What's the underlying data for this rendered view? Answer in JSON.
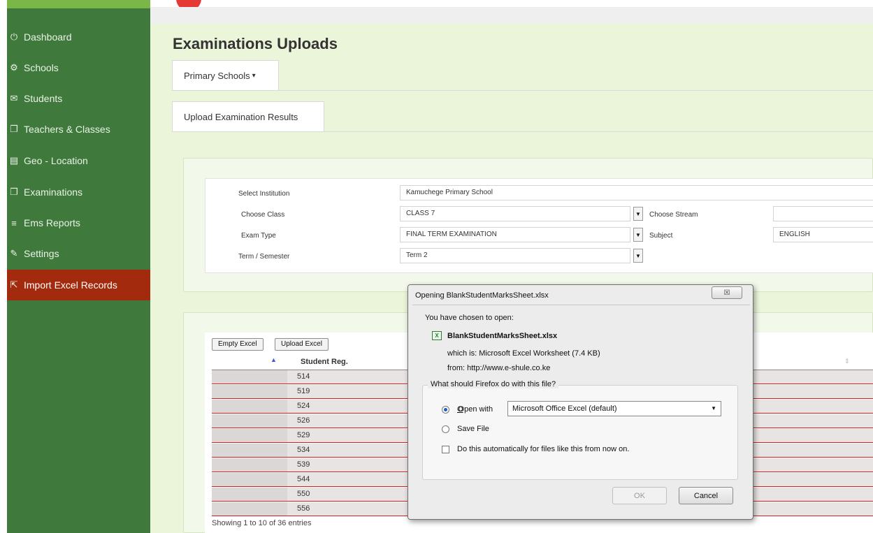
{
  "sidebar": {
    "items": [
      {
        "label": "Dashboard",
        "icon": "power-icon",
        "glyph": "⏻"
      },
      {
        "label": "Schools",
        "icon": "gear-icon",
        "glyph": "⚙"
      },
      {
        "label": "Students",
        "icon": "envelope-icon",
        "glyph": "✉"
      },
      {
        "label": "Teachers & Classes",
        "icon": "book-icon",
        "glyph": "❐"
      },
      {
        "label": "Geo - Location",
        "icon": "map-icon",
        "glyph": "▤"
      },
      {
        "label": "Examinations",
        "icon": "book-icon",
        "glyph": "❐"
      },
      {
        "label": "Ems Reports",
        "icon": "list-icon",
        "glyph": "≡"
      },
      {
        "label": "Settings",
        "icon": "pencil-icon",
        "glyph": "✎"
      },
      {
        "label": "Import Excel Records",
        "icon": "import-icon",
        "glyph": "⇱"
      }
    ]
  },
  "main": {
    "page_title": "Examinations Uploads",
    "tab_primary": "Primary Schools",
    "tab_primary_caret": "▾",
    "tab_upload": "Upload Examination Results",
    "form": {
      "institution_label": "Select Institution",
      "institution_value": "Kamuchege Primary School",
      "class_label": "Choose Class",
      "class_value": "CLASS 7",
      "stream_label": "Choose Stream",
      "stream_value": "",
      "exam_type_label": "Exam Type",
      "exam_type_value": "FINAL TERM EXAMINATION",
      "subject_label": "Subject",
      "subject_value": "ENGLISH",
      "term_label": "Term / Semester",
      "term_value": "Term 2",
      "dropdown_glyph": "▼"
    },
    "table": {
      "btn_empty": "Empty Excel",
      "btn_upload": "Upload Excel",
      "col_reg": "Student Reg.",
      "sort_up": "▲",
      "sort_both": "⇕",
      "rows": [
        "514",
        "519",
        "524",
        "526",
        "529",
        "534",
        "539",
        "544",
        "550",
        "556"
      ],
      "entries_text": "Showing 1 to 10 of 36 entries"
    }
  },
  "dialog": {
    "title": "Opening BlankStudentMarksSheet.xlsx",
    "close_glyph": "☒",
    "chosen_text": "You have chosen to open:",
    "file_icon_glyph": "X",
    "file_name": "BlankStudentMarksSheet.xlsx",
    "which_is": "which is: Microsoft Excel Worksheet (7.4 KB)",
    "from": "from: http://www.e-shule.co.ke",
    "question": "What should Firefox do with this file?",
    "open_with_label": "Open with",
    "open_with_value": "Microsoft Office Excel (default)",
    "select_glyph": "▼",
    "save_file_label": "Save File",
    "auto_label": "Do this automatically for files like this from now on.",
    "ok_label": "OK",
    "cancel_label": "Cancel"
  }
}
